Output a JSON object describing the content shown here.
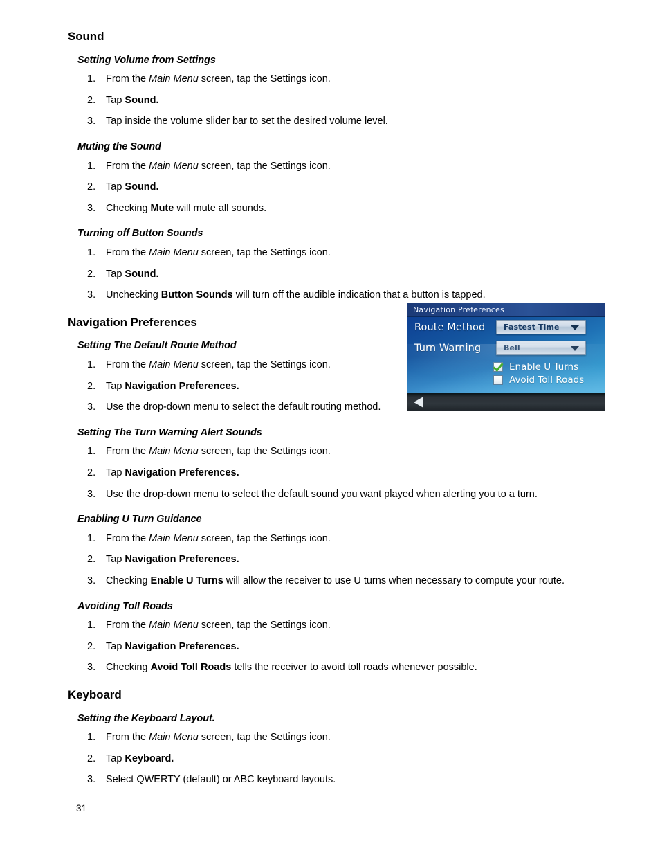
{
  "page": {
    "number": "31"
  },
  "sections": [
    {
      "title": "Sound",
      "subsections": [
        {
          "title": "Setting Volume from Settings",
          "steps": [
            "From the <i>Main Menu</i> screen, tap the Settings icon.",
            "Tap <b>Sound.</b>",
            "Tap inside the volume slider bar to set the desired volume level."
          ]
        },
        {
          "title": "Muting the Sound",
          "steps": [
            "From the <i>Main Menu</i> screen, tap the Settings icon.",
            "Tap <b>Sound.</b>",
            "Checking <b>Mute</b> will mute all sounds."
          ]
        },
        {
          "title": "Turning off Button Sounds",
          "steps": [
            "From the <i>Main Menu</i> screen, tap the Settings icon.",
            "Tap <b>Sound.</b>",
            "Unchecking <b>Button Sounds</b> will turn off the audible indication that a button is tapped."
          ]
        }
      ]
    },
    {
      "title": "Navigation Preferences",
      "subsections": [
        {
          "title": "Setting The Default Route Method",
          "narrow": true,
          "steps": [
            "From the <i>Main Menu</i> screen, tap the Settings icon.",
            "Tap <b>Navigation Preferences.</b>",
            "Use the drop-down menu to select the default routing method."
          ]
        },
        {
          "title": "Setting The Turn Warning Alert Sounds",
          "steps": [
            "From the <i>Main Menu</i> screen, tap the Settings icon.",
            "Tap <b>Navigation Preferences.</b>",
            "Use the drop-down menu to select the default sound you want played when alerting you to a turn."
          ]
        },
        {
          "title": "Enabling U Turn Guidance",
          "steps": [
            "From the <i>Main Menu</i> screen, tap the Settings icon.",
            "Tap <b>Navigation Preferences.</b>",
            "Checking <b>Enable U Turns</b> will allow the receiver to use U turns when necessary to compute your route."
          ]
        },
        {
          "title": "Avoiding Toll Roads",
          "steps": [
            "From the <i>Main Menu</i> screen, tap the Settings icon.",
            "Tap <b>Navigation Preferences.</b>",
            "Checking <b>Avoid Toll Roads</b> tells the receiver to avoid toll roads whenever possible."
          ]
        }
      ]
    },
    {
      "title": "Keyboard",
      "subsections": [
        {
          "title": "Setting the Keyboard Layout.",
          "steps": [
            "From the <i>Main Menu</i> screen, tap the Settings icon.",
            "Tap <b>Keyboard.</b>",
            "Select QWERTY (default) or ABC keyboard layouts."
          ]
        }
      ]
    }
  ],
  "device_screenshot": {
    "title": "Navigation Preferences",
    "rows": [
      {
        "label": "Route Method",
        "value": "Fastest Time"
      },
      {
        "label": "Turn Warning",
        "value": "Bell"
      }
    ],
    "checkboxes": [
      {
        "label": "Enable U Turns",
        "checked": true
      },
      {
        "label": "Avoid Toll Roads",
        "checked": false
      }
    ],
    "back_arrow": "back-arrow-icon",
    "colors": {
      "titlebar": "#24488b",
      "screen_top": "#0d3f93",
      "screen_bottom": "#46a9d8",
      "check_green": "#3aa81f",
      "dropdown_text": "#173a63",
      "bottom_bar": "#2a3036"
    }
  }
}
